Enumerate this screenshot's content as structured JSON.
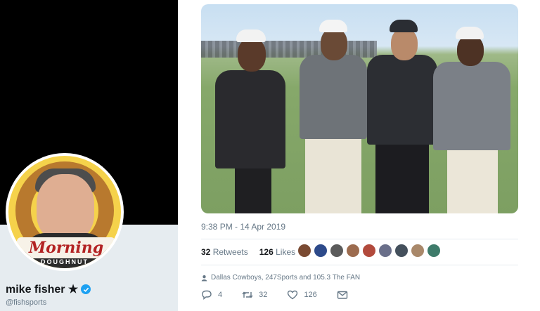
{
  "profile": {
    "name": "mike fisher ★",
    "handle": "@fishsports",
    "avatar_banner_text": "Morning",
    "avatar_sub_text": "DOUGHNUT"
  },
  "tweet": {
    "timestamp": "9:38 PM - 14 Apr 2019",
    "retweets_count": "32",
    "retweets_label": "Retweets",
    "likes_count": "126",
    "likes_label": "Likes",
    "likers_colors": [
      "#7a4a32",
      "#2d4a8a",
      "#5b5b5b",
      "#9c6b4e",
      "#b24a3c",
      "#6a6f8a",
      "#44505c",
      "#a9886a",
      "#3e7b6a"
    ],
    "context_text": "Dallas Cowboys, 247Sports and 105.3 The FAN",
    "actions": {
      "reply_count": "4",
      "retweet_count": "32",
      "like_count": "126"
    }
  },
  "colors": {
    "accent": "#1da1f2",
    "muted": "#657786"
  }
}
